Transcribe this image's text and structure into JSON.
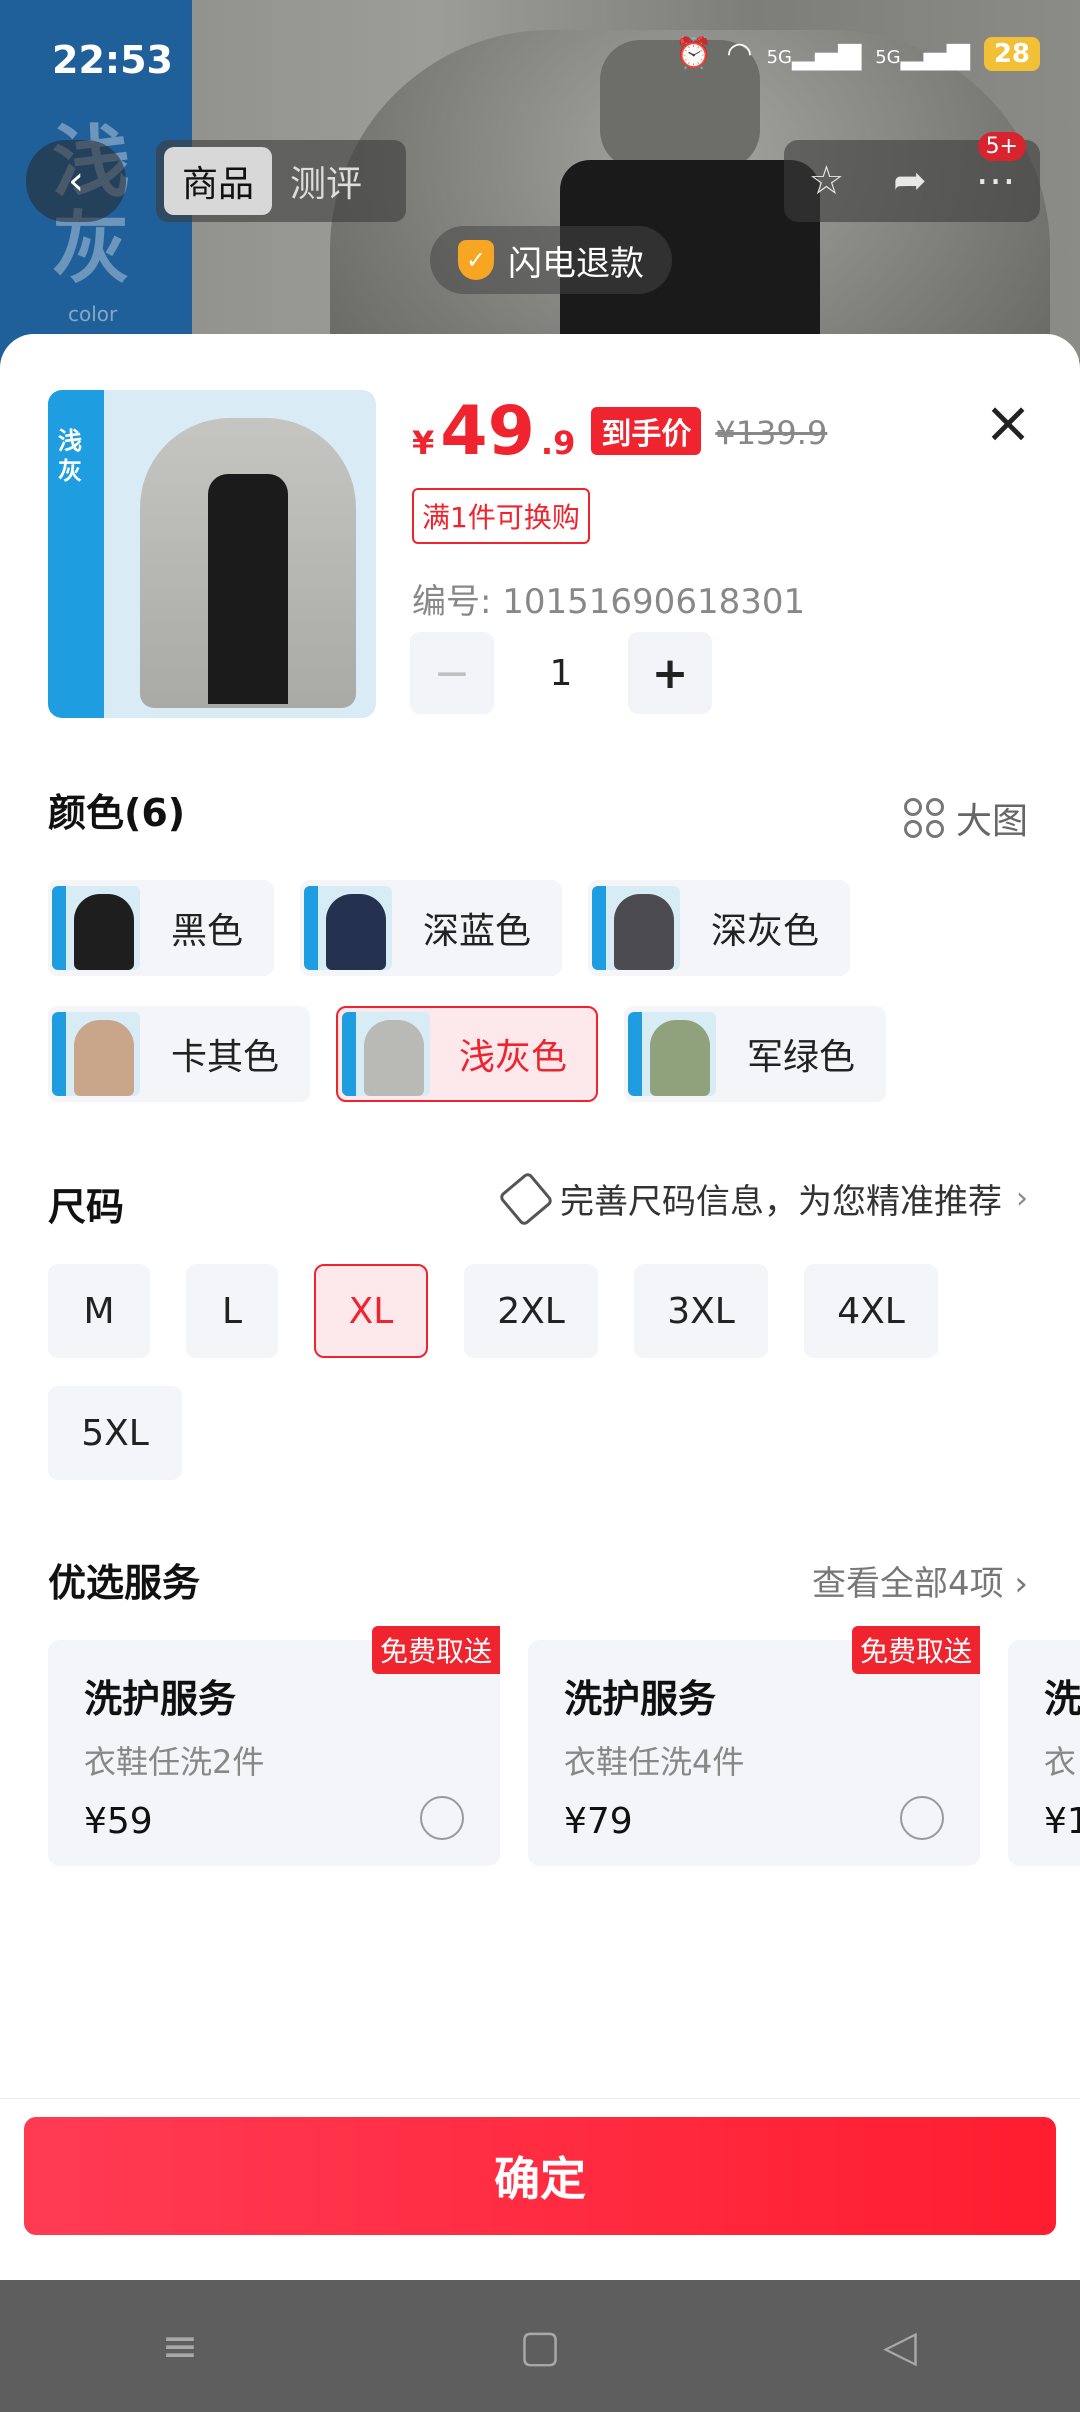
{
  "status": {
    "time": "22:53",
    "network1": "5G",
    "network2": "5G",
    "battery": "28"
  },
  "background": {
    "banner_text": "浅灰",
    "banner_sub": "color"
  },
  "nav": {
    "tabs": [
      {
        "label": "商品",
        "active": true
      },
      {
        "label": "测评",
        "active": false
      }
    ],
    "badge": "5+",
    "refund_tip": "闪电退款"
  },
  "product": {
    "thumb_label": "浅灰",
    "price_symbol": "¥",
    "price_int": "49",
    "price_dec": ".9",
    "hand_price_label": "到手价",
    "original_price": "¥139.9",
    "swap_tag": "满1件可换购",
    "sku_code": "编号: 10151690618301",
    "quantity": "1",
    "minus": "−",
    "plus": "+"
  },
  "colors": {
    "title": "颜色(6)",
    "big_image": "大图",
    "options": [
      {
        "label": "黑色",
        "swatch": "#1e1e1e",
        "selected": false
      },
      {
        "label": "深蓝色",
        "swatch": "#25324f",
        "selected": false
      },
      {
        "label": "深灰色",
        "swatch": "#4b4b50",
        "selected": false
      },
      {
        "label": "卡其色",
        "swatch": "#c9a58a",
        "selected": false
      },
      {
        "label": "浅灰色",
        "swatch": "#b9b9b6",
        "selected": true
      },
      {
        "label": "军绿色",
        "swatch": "#8fa27c",
        "selected": false
      }
    ]
  },
  "sizes": {
    "title": "尺码",
    "guide": "完善尺码信息，为您精准推荐",
    "options": [
      {
        "label": "M",
        "selected": false
      },
      {
        "label": "L",
        "selected": false
      },
      {
        "label": "XL",
        "selected": true
      },
      {
        "label": "2XL",
        "selected": false
      },
      {
        "label": "3XL",
        "selected": false
      },
      {
        "label": "4XL",
        "selected": false
      },
      {
        "label": "5XL",
        "selected": false
      }
    ]
  },
  "services": {
    "title": "优选服务",
    "view_all": "查看全部4项 ›",
    "items": [
      {
        "badge": "免费取送",
        "title": "洗护服务",
        "sub": "衣鞋任洗2件",
        "price": "¥59"
      },
      {
        "badge": "免费取送",
        "title": "洗护服务",
        "sub": "衣鞋任洗4件",
        "price": "¥79"
      },
      {
        "badge": "",
        "title": "洗",
        "sub": "衣",
        "price": "¥1"
      }
    ]
  },
  "confirm": {
    "label": "确定"
  },
  "colors_theme": {
    "accent": "#f0242e",
    "chip_bg": "#f4f5f9"
  }
}
